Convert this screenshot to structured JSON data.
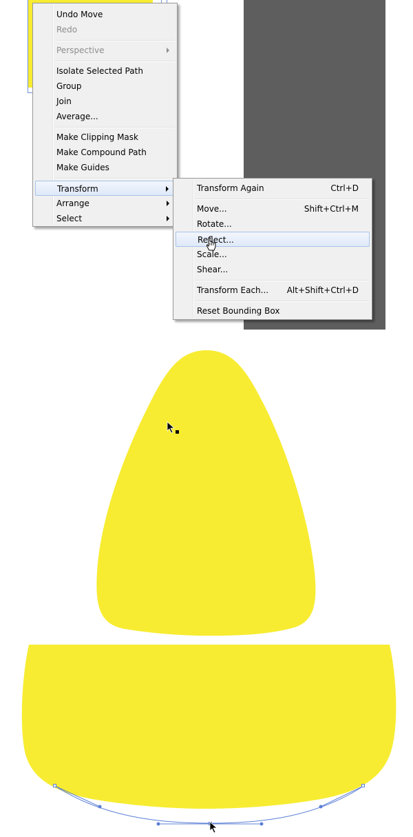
{
  "context_menu": {
    "items": [
      {
        "label": "Undo Move"
      },
      {
        "label": "Redo"
      },
      {
        "label": "Perspective"
      },
      {
        "label": "Isolate Selected Path"
      },
      {
        "label": "Group"
      },
      {
        "label": "Join"
      },
      {
        "label": "Average..."
      },
      {
        "label": "Make Clipping Mask"
      },
      {
        "label": "Make Compound Path"
      },
      {
        "label": "Make Guides"
      },
      {
        "label": "Transform"
      },
      {
        "label": "Arrange"
      },
      {
        "label": "Select"
      }
    ]
  },
  "transform_submenu": {
    "items": [
      {
        "label": "Transform Again",
        "shortcut": "Ctrl+D"
      },
      {
        "label": "Move...",
        "shortcut": "Shift+Ctrl+M"
      },
      {
        "label": "Rotate...",
        "shortcut": ""
      },
      {
        "label": "Reflect...",
        "shortcut": ""
      },
      {
        "label": "Scale...",
        "shortcut": ""
      },
      {
        "label": "Shear...",
        "shortcut": ""
      },
      {
        "label": "Transform Each...",
        "shortcut": "Alt+Shift+Ctrl+D"
      },
      {
        "label": "Reset Bounding Box",
        "shortcut": ""
      }
    ]
  },
  "colors": {
    "shape_fill": "#f7ec31",
    "pasteboard": "#5e5e5e",
    "selection": "#5b7fd6",
    "menu_bg": "#f0f0f0",
    "menu_highlight": "#dfe9f8"
  },
  "icons": [
    "submenu-arrow-icon",
    "hand-pointer-cursor-icon",
    "direct-selection-cursor-icon",
    "selection-cursor-icon"
  ]
}
